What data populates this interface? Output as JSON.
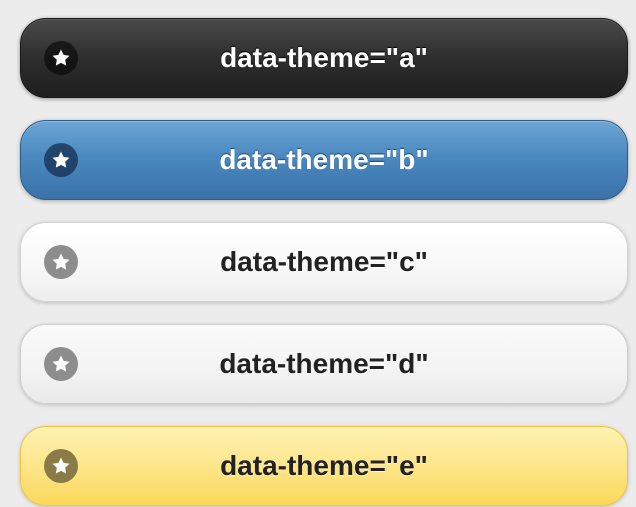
{
  "buttons": [
    {
      "theme": "a",
      "label": "data-theme=\"a\"",
      "icon": "star-icon"
    },
    {
      "theme": "b",
      "label": "data-theme=\"b\"",
      "icon": "star-icon"
    },
    {
      "theme": "c",
      "label": "data-theme=\"c\"",
      "icon": "star-icon"
    },
    {
      "theme": "d",
      "label": "data-theme=\"d\"",
      "icon": "star-icon"
    },
    {
      "theme": "e",
      "label": "data-theme=\"e\"",
      "icon": "star-icon"
    }
  ],
  "colors": {
    "background": "#ececec",
    "theme_a": "#2e2e2e",
    "theme_b": "#4a89c0",
    "theme_c": "#f7f7f7",
    "theme_d": "#f3f3f3",
    "theme_e": "#fde58a"
  }
}
